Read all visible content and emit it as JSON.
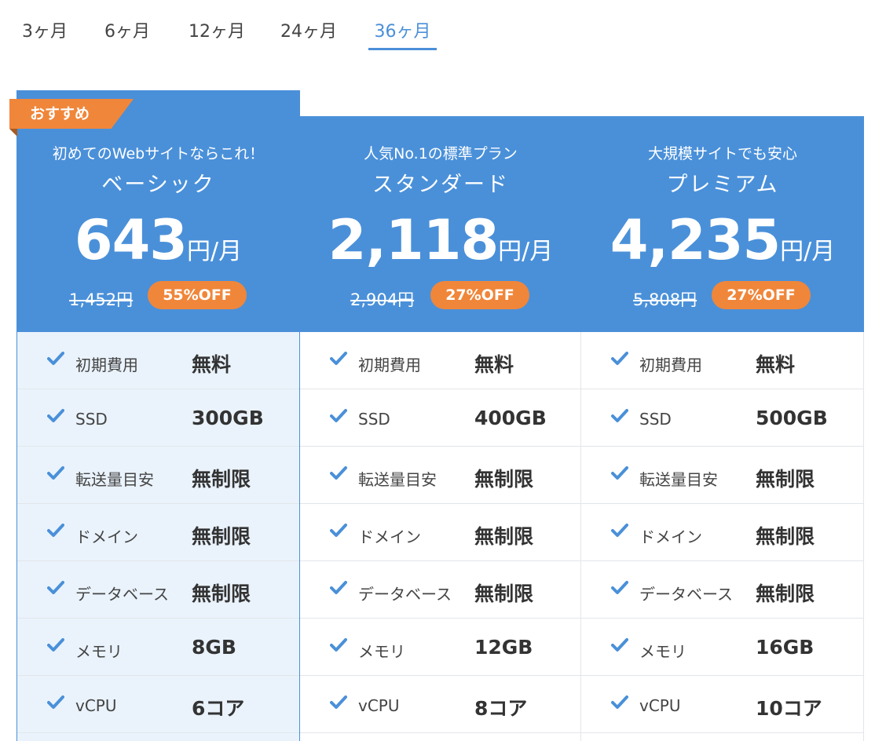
{
  "tabs": [
    {
      "label": "3ヶ月",
      "active": false
    },
    {
      "label": "6ヶ月",
      "active": false
    },
    {
      "label": "12ヶ月",
      "active": false
    },
    {
      "label": "24ヶ月",
      "active": false
    },
    {
      "label": "36ヶ月",
      "active": true
    }
  ],
  "colors": {
    "accent": "#4a90d9",
    "badge": "#f0863a",
    "highlight_bg": "#eaf3fc"
  },
  "ribbon": {
    "label": "おすすめ"
  },
  "feature_labels": [
    "初期費用",
    "SSD",
    "転送量目安",
    "ドメイン",
    "データベース",
    "メモリ",
    "vCPU"
  ],
  "plans": [
    {
      "subtitle": "初めてのWebサイトならこれ！",
      "name": "ベーシック",
      "price": "643",
      "unit": "円/月",
      "original_price": "1,452円",
      "discount": "55%OFF",
      "values": [
        "無料",
        "300GB",
        "無制限",
        "無制限",
        "無制限",
        "8GB",
        "6コア"
      ]
    },
    {
      "subtitle": "人気No.1の標準プラン",
      "name": "スタンダード",
      "price": "2,118",
      "unit": "円/月",
      "original_price": "2,904円",
      "discount": "27%OFF",
      "values": [
        "無料",
        "400GB",
        "無制限",
        "無制限",
        "無制限",
        "12GB",
        "8コア"
      ]
    },
    {
      "subtitle": "大規模サイトでも安心",
      "name": "プレミアム",
      "price": "4,235",
      "unit": "円/月",
      "original_price": "5,808円",
      "discount": "27%OFF",
      "values": [
        "無料",
        "500GB",
        "無制限",
        "無制限",
        "無制限",
        "16GB",
        "10コア"
      ]
    }
  ]
}
